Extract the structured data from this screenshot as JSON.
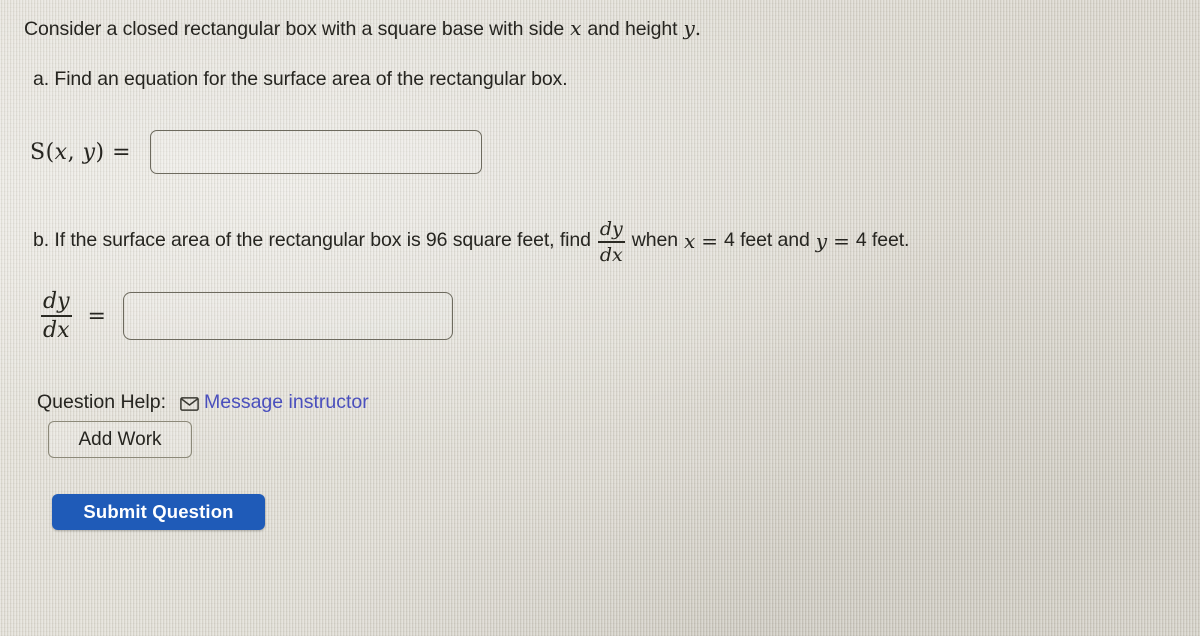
{
  "colors": {
    "page_background": "#dbd8cf",
    "text": "#262520",
    "link": "#4a4fbd",
    "submit_button_background": "#1f5bb8",
    "submit_button_text": "#ffffff",
    "input_border": "#6d6a5e",
    "button_border": "#8c8979"
  },
  "prompt": {
    "before_x": "Consider a closed rectangular box with a square base with side",
    "var_x": "x",
    "between": "and height",
    "var_y": "y",
    "period": "."
  },
  "part_a": {
    "text": "a. Find an equation for the surface area of the rectangular box.",
    "answer": {
      "label_s": "S",
      "label_open": "(",
      "label_x": "x",
      "label_comma": ",",
      "label_y": "y",
      "label_close": ")",
      "label_equals": "=",
      "input_value": "",
      "input_placeholder": ""
    }
  },
  "part_b": {
    "text_before_frac": "b. If the surface area of the rectangular box is 96 square feet, find",
    "frac_numerator": "dy",
    "frac_denominator": "dx",
    "text_when": "when",
    "var_x": "x",
    "eq_1": "=",
    "value_x": "4 feet and",
    "var_y": "y",
    "eq_2": "=",
    "value_y": "4 feet.",
    "answer": {
      "frac_numerator": "dy",
      "frac_denominator": "dx",
      "equals": "=",
      "input_value": "",
      "input_placeholder": ""
    }
  },
  "question_help": {
    "label": "Question Help:",
    "link_label": "Message instructor",
    "link_icon": "envelope-icon"
  },
  "buttons": {
    "add_work": "Add Work",
    "submit_question": "Submit Question"
  }
}
